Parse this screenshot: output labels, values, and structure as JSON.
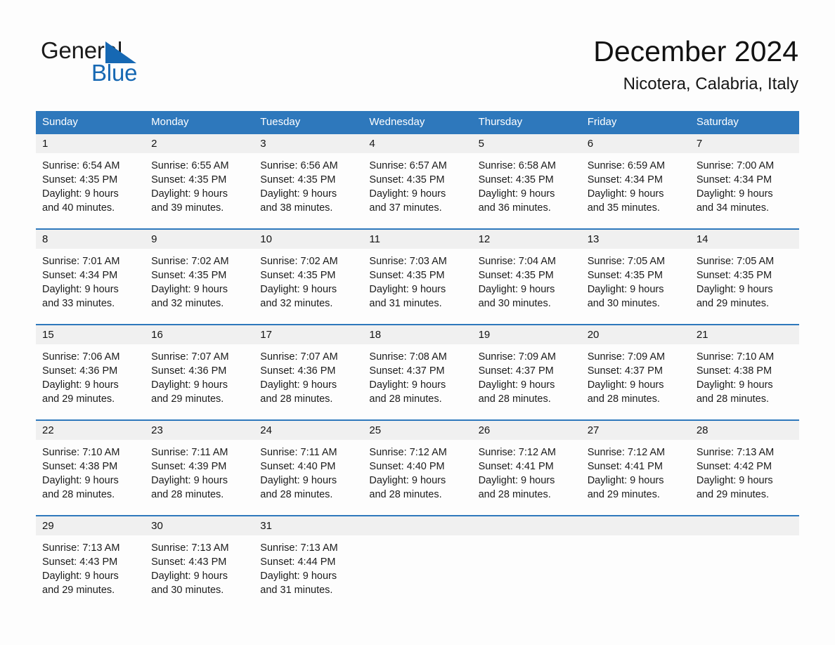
{
  "logo": {
    "word_one": "General",
    "word_two": "Blue",
    "triangle_icon": "triangle-icon",
    "brand_blue": "#1668b3"
  },
  "header": {
    "month_title": "December 2024",
    "location": "Nicotera, Calabria, Italy"
  },
  "theme": {
    "header_blue": "#2e78bc",
    "row_separator_blue": "#2e78bc",
    "day_number_band": "#f0f0f0",
    "page_background": "#fdfdfd",
    "text_color": "#1b1b1b"
  },
  "calendar": {
    "weekday_headers": [
      "Sunday",
      "Monday",
      "Tuesday",
      "Wednesday",
      "Thursday",
      "Friday",
      "Saturday"
    ],
    "weeks": [
      [
        {
          "day": "1",
          "sunrise": "Sunrise: 6:54 AM",
          "sunset": "Sunset: 4:35 PM",
          "daylight_1": "Daylight: 9 hours",
          "daylight_2": "and 40 minutes."
        },
        {
          "day": "2",
          "sunrise": "Sunrise: 6:55 AM",
          "sunset": "Sunset: 4:35 PM",
          "daylight_1": "Daylight: 9 hours",
          "daylight_2": "and 39 minutes."
        },
        {
          "day": "3",
          "sunrise": "Sunrise: 6:56 AM",
          "sunset": "Sunset: 4:35 PM",
          "daylight_1": "Daylight: 9 hours",
          "daylight_2": "and 38 minutes."
        },
        {
          "day": "4",
          "sunrise": "Sunrise: 6:57 AM",
          "sunset": "Sunset: 4:35 PM",
          "daylight_1": "Daylight: 9 hours",
          "daylight_2": "and 37 minutes."
        },
        {
          "day": "5",
          "sunrise": "Sunrise: 6:58 AM",
          "sunset": "Sunset: 4:35 PM",
          "daylight_1": "Daylight: 9 hours",
          "daylight_2": "and 36 minutes."
        },
        {
          "day": "6",
          "sunrise": "Sunrise: 6:59 AM",
          "sunset": "Sunset: 4:34 PM",
          "daylight_1": "Daylight: 9 hours",
          "daylight_2": "and 35 minutes."
        },
        {
          "day": "7",
          "sunrise": "Sunrise: 7:00 AM",
          "sunset": "Sunset: 4:34 PM",
          "daylight_1": "Daylight: 9 hours",
          "daylight_2": "and 34 minutes."
        }
      ],
      [
        {
          "day": "8",
          "sunrise": "Sunrise: 7:01 AM",
          "sunset": "Sunset: 4:34 PM",
          "daylight_1": "Daylight: 9 hours",
          "daylight_2": "and 33 minutes."
        },
        {
          "day": "9",
          "sunrise": "Sunrise: 7:02 AM",
          "sunset": "Sunset: 4:35 PM",
          "daylight_1": "Daylight: 9 hours",
          "daylight_2": "and 32 minutes."
        },
        {
          "day": "10",
          "sunrise": "Sunrise: 7:02 AM",
          "sunset": "Sunset: 4:35 PM",
          "daylight_1": "Daylight: 9 hours",
          "daylight_2": "and 32 minutes."
        },
        {
          "day": "11",
          "sunrise": "Sunrise: 7:03 AM",
          "sunset": "Sunset: 4:35 PM",
          "daylight_1": "Daylight: 9 hours",
          "daylight_2": "and 31 minutes."
        },
        {
          "day": "12",
          "sunrise": "Sunrise: 7:04 AM",
          "sunset": "Sunset: 4:35 PM",
          "daylight_1": "Daylight: 9 hours",
          "daylight_2": "and 30 minutes."
        },
        {
          "day": "13",
          "sunrise": "Sunrise: 7:05 AM",
          "sunset": "Sunset: 4:35 PM",
          "daylight_1": "Daylight: 9 hours",
          "daylight_2": "and 30 minutes."
        },
        {
          "day": "14",
          "sunrise": "Sunrise: 7:05 AM",
          "sunset": "Sunset: 4:35 PM",
          "daylight_1": "Daylight: 9 hours",
          "daylight_2": "and 29 minutes."
        }
      ],
      [
        {
          "day": "15",
          "sunrise": "Sunrise: 7:06 AM",
          "sunset": "Sunset: 4:36 PM",
          "daylight_1": "Daylight: 9 hours",
          "daylight_2": "and 29 minutes."
        },
        {
          "day": "16",
          "sunrise": "Sunrise: 7:07 AM",
          "sunset": "Sunset: 4:36 PM",
          "daylight_1": "Daylight: 9 hours",
          "daylight_2": "and 29 minutes."
        },
        {
          "day": "17",
          "sunrise": "Sunrise: 7:07 AM",
          "sunset": "Sunset: 4:36 PM",
          "daylight_1": "Daylight: 9 hours",
          "daylight_2": "and 28 minutes."
        },
        {
          "day": "18",
          "sunrise": "Sunrise: 7:08 AM",
          "sunset": "Sunset: 4:37 PM",
          "daylight_1": "Daylight: 9 hours",
          "daylight_2": "and 28 minutes."
        },
        {
          "day": "19",
          "sunrise": "Sunrise: 7:09 AM",
          "sunset": "Sunset: 4:37 PM",
          "daylight_1": "Daylight: 9 hours",
          "daylight_2": "and 28 minutes."
        },
        {
          "day": "20",
          "sunrise": "Sunrise: 7:09 AM",
          "sunset": "Sunset: 4:37 PM",
          "daylight_1": "Daylight: 9 hours",
          "daylight_2": "and 28 minutes."
        },
        {
          "day": "21",
          "sunrise": "Sunrise: 7:10 AM",
          "sunset": "Sunset: 4:38 PM",
          "daylight_1": "Daylight: 9 hours",
          "daylight_2": "and 28 minutes."
        }
      ],
      [
        {
          "day": "22",
          "sunrise": "Sunrise: 7:10 AM",
          "sunset": "Sunset: 4:38 PM",
          "daylight_1": "Daylight: 9 hours",
          "daylight_2": "and 28 minutes."
        },
        {
          "day": "23",
          "sunrise": "Sunrise: 7:11 AM",
          "sunset": "Sunset: 4:39 PM",
          "daylight_1": "Daylight: 9 hours",
          "daylight_2": "and 28 minutes."
        },
        {
          "day": "24",
          "sunrise": "Sunrise: 7:11 AM",
          "sunset": "Sunset: 4:40 PM",
          "daylight_1": "Daylight: 9 hours",
          "daylight_2": "and 28 minutes."
        },
        {
          "day": "25",
          "sunrise": "Sunrise: 7:12 AM",
          "sunset": "Sunset: 4:40 PM",
          "daylight_1": "Daylight: 9 hours",
          "daylight_2": "and 28 minutes."
        },
        {
          "day": "26",
          "sunrise": "Sunrise: 7:12 AM",
          "sunset": "Sunset: 4:41 PM",
          "daylight_1": "Daylight: 9 hours",
          "daylight_2": "and 28 minutes."
        },
        {
          "day": "27",
          "sunrise": "Sunrise: 7:12 AM",
          "sunset": "Sunset: 4:41 PM",
          "daylight_1": "Daylight: 9 hours",
          "daylight_2": "and 29 minutes."
        },
        {
          "day": "28",
          "sunrise": "Sunrise: 7:13 AM",
          "sunset": "Sunset: 4:42 PM",
          "daylight_1": "Daylight: 9 hours",
          "daylight_2": "and 29 minutes."
        }
      ],
      [
        {
          "day": "29",
          "sunrise": "Sunrise: 7:13 AM",
          "sunset": "Sunset: 4:43 PM",
          "daylight_1": "Daylight: 9 hours",
          "daylight_2": "and 29 minutes."
        },
        {
          "day": "30",
          "sunrise": "Sunrise: 7:13 AM",
          "sunset": "Sunset: 4:43 PM",
          "daylight_1": "Daylight: 9 hours",
          "daylight_2": "and 30 minutes."
        },
        {
          "day": "31",
          "sunrise": "Sunrise: 7:13 AM",
          "sunset": "Sunset: 4:44 PM",
          "daylight_1": "Daylight: 9 hours",
          "daylight_2": "and 31 minutes."
        },
        {
          "day": "",
          "sunrise": "",
          "sunset": "",
          "daylight_1": "",
          "daylight_2": ""
        },
        {
          "day": "",
          "sunrise": "",
          "sunset": "",
          "daylight_1": "",
          "daylight_2": ""
        },
        {
          "day": "",
          "sunrise": "",
          "sunset": "",
          "daylight_1": "",
          "daylight_2": ""
        },
        {
          "day": "",
          "sunrise": "",
          "sunset": "",
          "daylight_1": "",
          "daylight_2": ""
        }
      ]
    ]
  }
}
